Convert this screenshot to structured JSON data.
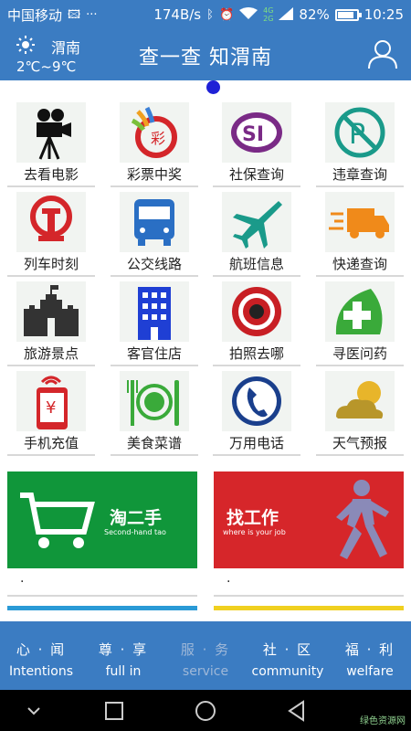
{
  "status_bar": {
    "carrier": "中国移动",
    "speed": "174B/s",
    "battery": "82%",
    "time": "10:25",
    "net_a": "4G",
    "net_b": "2G"
  },
  "header": {
    "city": "渭南",
    "temperature": "2℃~9℃",
    "title": "查一查 知渭南"
  },
  "services": [
    {
      "label": "去看电影",
      "icon": "movie-camera-icon"
    },
    {
      "label": "彩票中奖",
      "icon": "lottery-icon"
    },
    {
      "label": "社保查询",
      "icon": "social-security-icon"
    },
    {
      "label": "违章查询",
      "icon": "traffic-violation-icon"
    },
    {
      "label": "列车时刻",
      "icon": "railway-icon"
    },
    {
      "label": "公交线路",
      "icon": "bus-icon"
    },
    {
      "label": "航班信息",
      "icon": "airplane-icon"
    },
    {
      "label": "快递查询",
      "icon": "delivery-truck-icon"
    },
    {
      "label": "旅游景点",
      "icon": "great-wall-icon"
    },
    {
      "label": "客官住店",
      "icon": "hotel-icon"
    },
    {
      "label": "拍照去哪",
      "icon": "camera-lens-icon"
    },
    {
      "label": "寻医问药",
      "icon": "medical-cross-icon"
    },
    {
      "label": "手机充值",
      "icon": "phone-recharge-icon"
    },
    {
      "label": "美食菜谱",
      "icon": "food-icon"
    },
    {
      "label": "万用电话",
      "icon": "telephone-icon"
    },
    {
      "label": "天气预报",
      "icon": "weather-icon"
    }
  ],
  "banners": [
    {
      "title": "淘二手",
      "subtitle": "Second-hand tao",
      "caption": ".",
      "color": "#10963a"
    },
    {
      "title": "找工作",
      "subtitle": "where is your job",
      "caption": ".",
      "color": "#d6262a"
    }
  ],
  "tabs": [
    {
      "zh": "心 · 闻",
      "en": "Intentions"
    },
    {
      "zh": "尊 · 享",
      "en": "full in"
    },
    {
      "zh": "服 · 务",
      "en": "service"
    },
    {
      "zh": "社 · 区",
      "en": "community"
    },
    {
      "zh": "福 · 利",
      "en": "welfare"
    }
  ],
  "watermark": "绿色资源网",
  "colors": {
    "primary": "#3b7cc2",
    "indicator": "#1f21d6"
  }
}
